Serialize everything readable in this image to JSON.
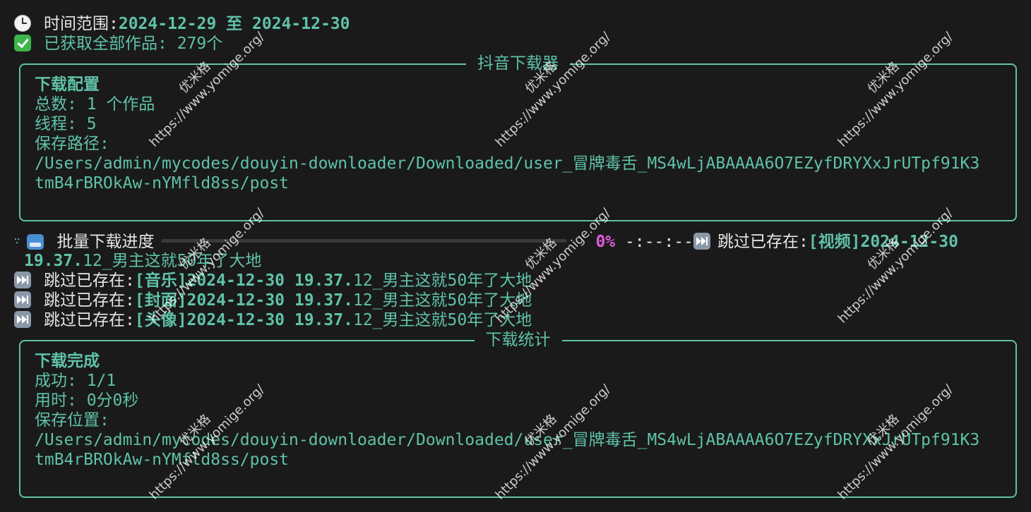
{
  "header": {
    "time_range_label": "时间范围:",
    "time_range_value": "2024-12-29 至 2024-12-30",
    "fetched_text": "已获取全部作品: 279个"
  },
  "config_panel": {
    "title": "抖音下载器",
    "heading": "下载配置",
    "total": "总数: 1 个作品",
    "threads": "线程: 5",
    "save_path_label": "保存路径:",
    "save_path_line1": "/Users/admin/mycodes/douyin-downloader/Downloaded/user_冒牌毒舌_MS4wLjABAAAA6O7EZyfDRYXxJrUTpf91K3",
    "save_path_line2": "tmB4rBROkAw-nYMfld8ss/post"
  },
  "progress": {
    "spinner": "∵",
    "label": "批量下载进度",
    "percent_value": 0,
    "percent_text": "0%",
    "eta": "-:--:--",
    "first_skip_prefix": "跳过已存在:",
    "first_skip_bracket": "[视频]2024-12-30",
    "first_skip_continuation_bold": "19.37.",
    "first_skip_continuation_rest": "12_男主这就50年了大地"
  },
  "skip_lines": [
    {
      "prefix": "跳过已存在:",
      "bold": "[音乐]2024-12-30 19.37.",
      "rest": "12_男主这就50年了大地"
    },
    {
      "prefix": "跳过已存在:",
      "bold": "[封面]2024-12-30 19.37.",
      "rest": "12_男主这就50年了大地"
    },
    {
      "prefix": "跳过已存在:",
      "bold": "[头像]2024-12-30 19.37.",
      "rest": "12_男主这就50年了大地"
    }
  ],
  "stats_panel": {
    "title": "下载统计",
    "heading": "下载完成",
    "success": "成功: 1/1",
    "time_used": "用时: 0分0秒",
    "save_location_label": "保存位置:",
    "save_path_line1": "/Users/admin/mycodes/douyin-downloader/Downloaded/user_冒牌毒舌_MS4wLjABAAAA6O7EZyfDRYXxJrUTpf91K3",
    "save_path_line2": "tmB4rBROkAw-nYMfld8ss/post"
  },
  "watermark": {
    "name": "优米格",
    "url": "https://www.yomige.org/"
  },
  "colors": {
    "background": "#1a1a1a",
    "accent": "#5fc2a8",
    "percent": "#e05adf"
  }
}
